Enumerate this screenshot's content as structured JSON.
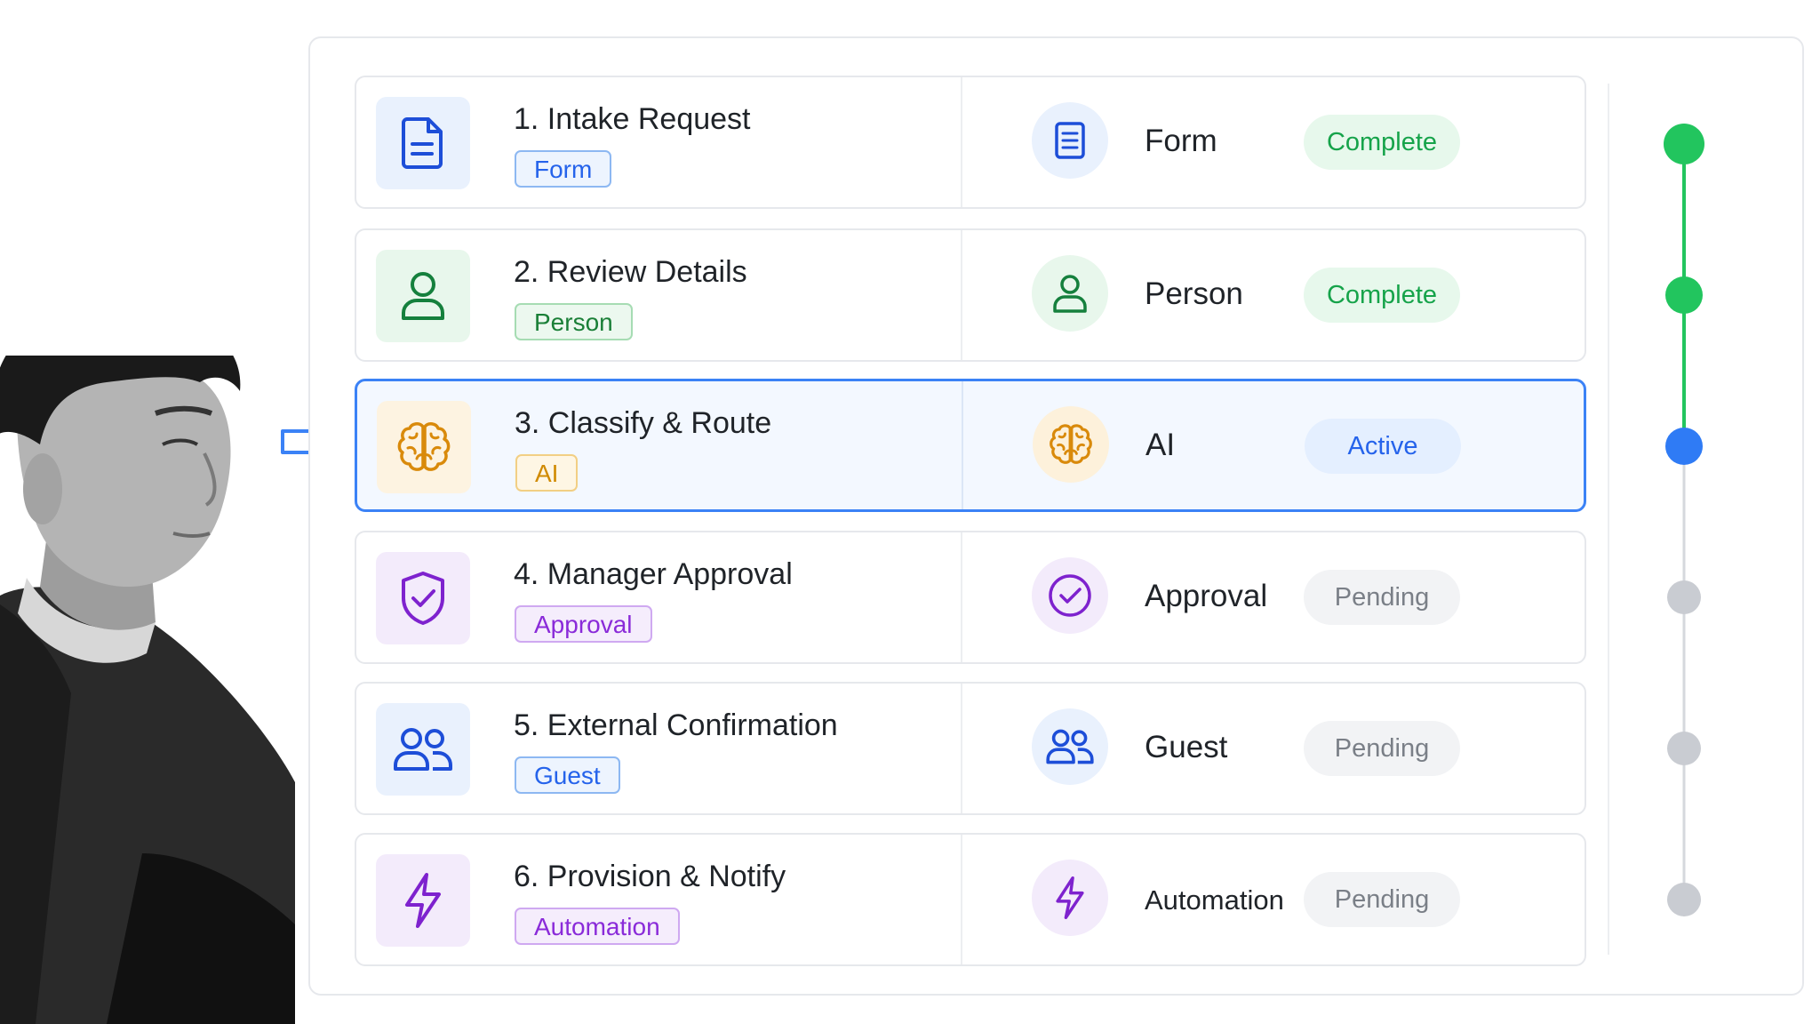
{
  "theme": {
    "complete_color": "#22c55e",
    "active_color": "#2f7bf5",
    "pending_color": "#c9ccd2",
    "accent_blue": "#2563eb"
  },
  "steps": [
    {
      "title": "1. Intake Request",
      "chip": "Form",
      "type_label": "Form",
      "status": "Complete",
      "icon": "document-icon",
      "theme": "blue"
    },
    {
      "title": "2. Review Details",
      "chip": "Person",
      "type_label": "Person",
      "status": "Complete",
      "icon": "person-icon",
      "theme": "green"
    },
    {
      "title": "3. Classify & Route",
      "chip": "AI",
      "type_label": "AI",
      "status": "Active",
      "icon": "brain-icon",
      "theme": "amber"
    },
    {
      "title": "4. Manager Approval",
      "chip": "Approval",
      "type_label": "Approval",
      "status": "Pending",
      "icon": "shield-check-icon",
      "theme": "purple"
    },
    {
      "title": "5. External Confirmation",
      "chip": "Guest",
      "type_label": "Guest",
      "status": "Pending",
      "icon": "users-icon",
      "theme": "blue"
    },
    {
      "title": "6. Provision & Notify",
      "chip": "Automation",
      "type_label": "Automation",
      "status": "Pending",
      "icon": "lightning-icon",
      "theme": "purple"
    }
  ]
}
